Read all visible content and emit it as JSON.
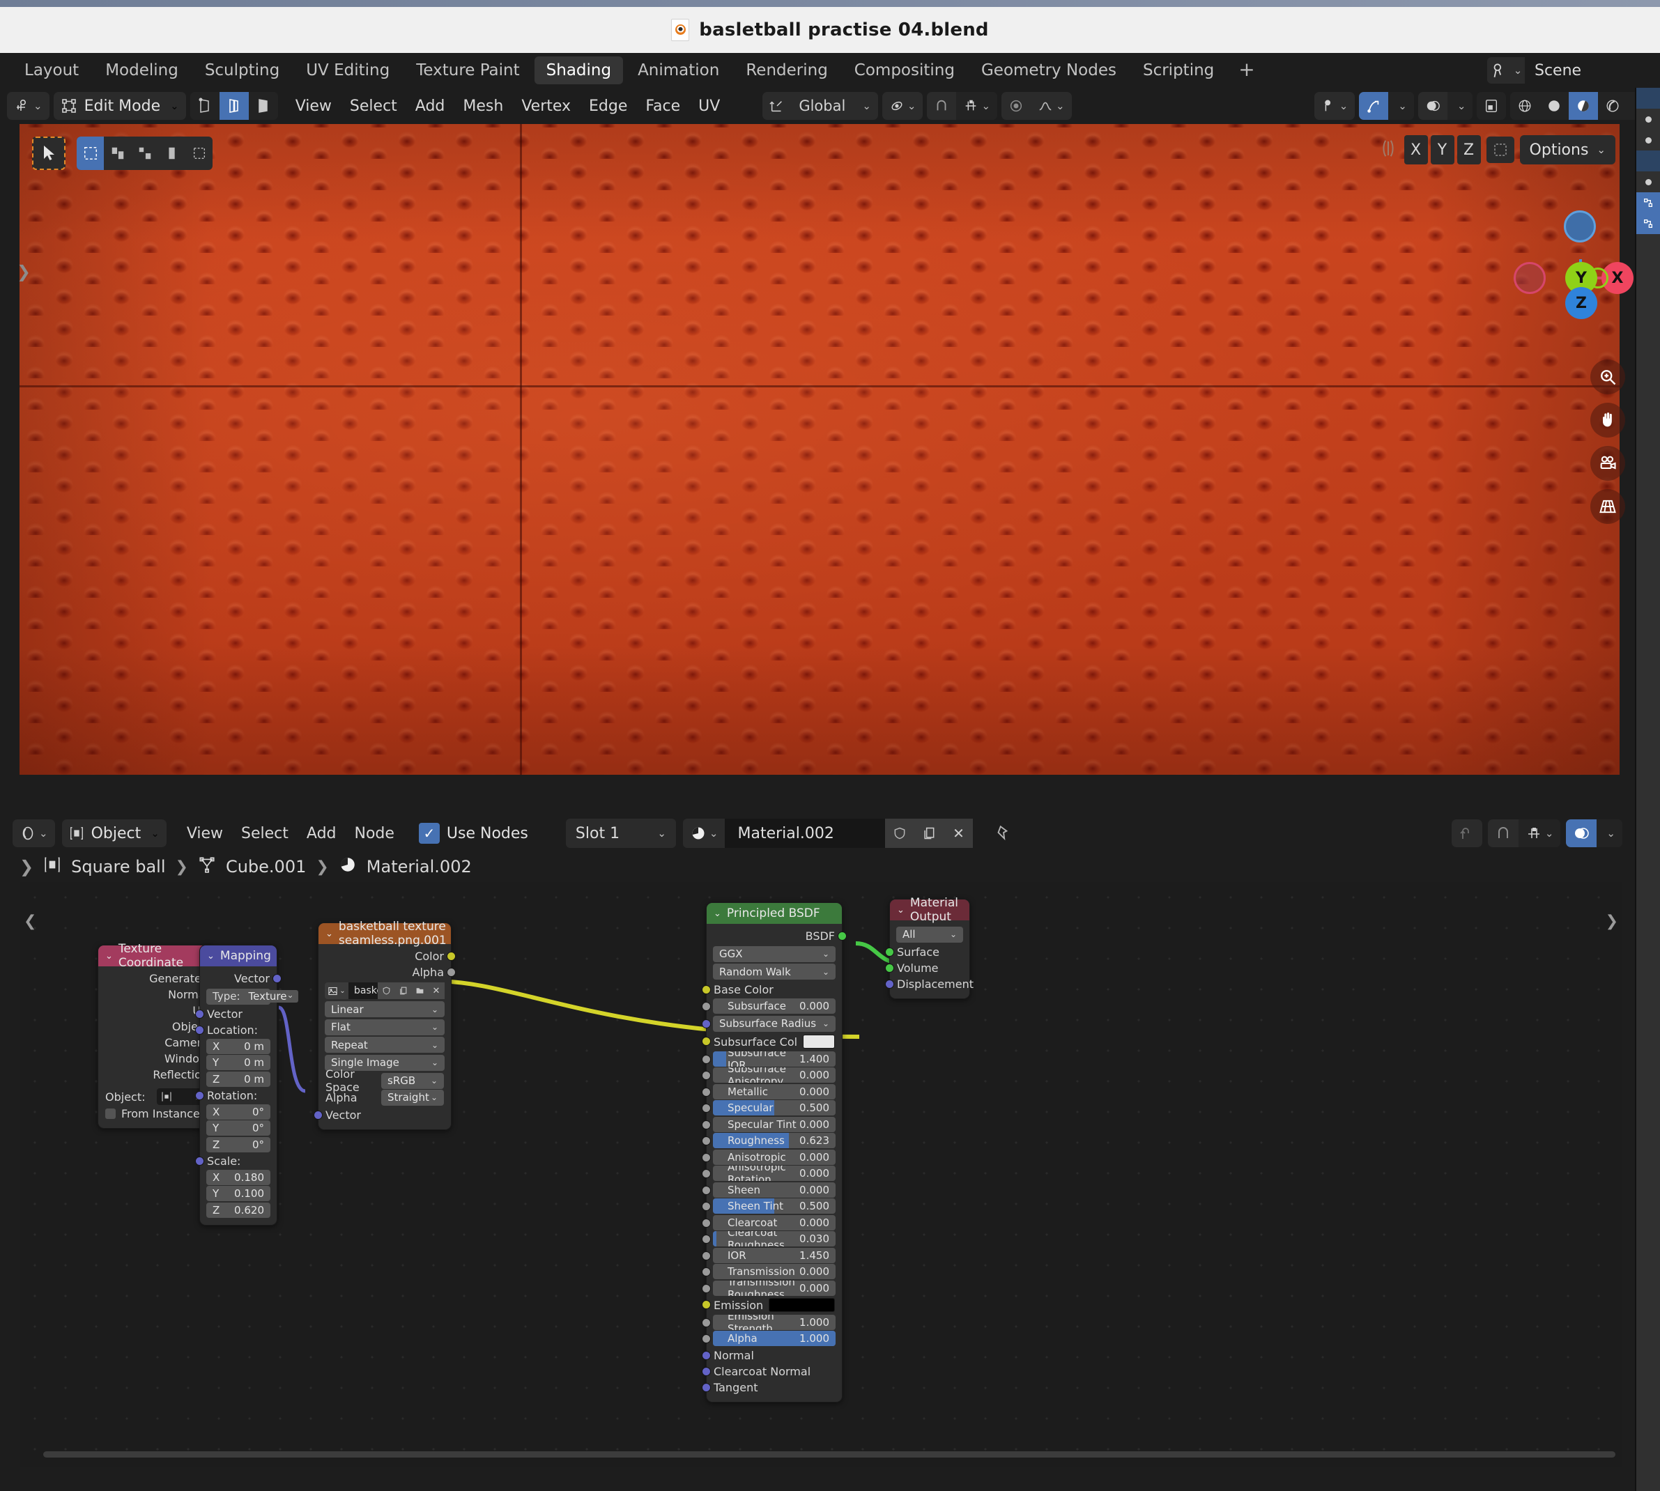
{
  "window": {
    "title": "basletball practise 04.blend",
    "file_icon": "blender-file-icon"
  },
  "topbar": {
    "workspaces": [
      {
        "label": "Layout",
        "active": false
      },
      {
        "label": "Modeling",
        "active": false
      },
      {
        "label": "Sculpting",
        "active": false
      },
      {
        "label": "UV Editing",
        "active": false
      },
      {
        "label": "Texture Paint",
        "active": false
      },
      {
        "label": "Shading",
        "active": true
      },
      {
        "label": "Animation",
        "active": false
      },
      {
        "label": "Rendering",
        "active": false
      },
      {
        "label": "Compositing",
        "active": false
      },
      {
        "label": "Geometry Nodes",
        "active": false
      },
      {
        "label": "Scripting",
        "active": false
      }
    ],
    "add_workspace": "+",
    "scene_name": "Scene"
  },
  "viewport": {
    "editor_type_icon": "editor-type-icon",
    "mode": "Edit Mode",
    "select_modes": [
      "vertex-select",
      "edge-select",
      "face-select"
    ],
    "select_mode_active": "edge-select",
    "menus": [
      "View",
      "Select",
      "Add",
      "Mesh",
      "Vertex",
      "Edge",
      "Face",
      "UV"
    ],
    "transform_orientation": "Global",
    "pivot_icon": "pivot-point-icon",
    "snap_icon": "magnet-icon",
    "snap_target_icon": "snap-increment-icon",
    "proportional_icon": "proportional-edit-icon",
    "falloff_icon": "smooth-falloff-icon",
    "visibility_icon": "visibility-icon",
    "gizmo_icon": "gizmo-icon",
    "overlays_icon": "overlays-icon",
    "xray_icon": "xray-icon",
    "shading_modes": [
      "wireframe",
      "solid",
      "material-preview",
      "rendered"
    ],
    "shading_active": "material-preview",
    "toolbar_select_icon": "tweak-select-icon",
    "mesh_select_icons": [
      "box-select",
      "lasso-select",
      "circle-select",
      "select-all"
    ],
    "axis_buttons": [
      "X",
      "Y",
      "Z"
    ],
    "mirror_icon": "mirror-icon",
    "options_label": "Options",
    "gizmo_axes": [
      "X",
      "Y",
      "Z"
    ],
    "nav_buttons": [
      "zoom-icon",
      "pan-hand-icon",
      "camera-view-icon",
      "toggle-perspective-icon"
    ]
  },
  "shader_editor": {
    "editor_icon": "shader-editor-icon",
    "shader_type": "Object",
    "menus": [
      "View",
      "Select",
      "Add",
      "Node"
    ],
    "use_nodes_label": "Use Nodes",
    "use_nodes_checked": true,
    "slot": "Slot 1",
    "material_name": "Material.002",
    "material_buttons": [
      "fake-user-shield-icon",
      "new-material-copy-icon",
      "unlink-x-icon"
    ],
    "pin_icon": "pin-icon",
    "right_icons": [
      "snap-parent-icon",
      "magnet-icon",
      "snap-node-icon",
      "overlays-icon"
    ],
    "breadcrumb": [
      {
        "icon": "object-icon",
        "label": "Square ball"
      },
      {
        "icon": "mesh-data-icon",
        "label": "Cube.001"
      },
      {
        "icon": "material-icon",
        "label": "Material.002"
      }
    ]
  },
  "nodes": {
    "texture_coordinate": {
      "title": "Texture Coordinate",
      "header_color": "#a33b5e",
      "outputs": [
        "Generated",
        "Normal",
        "UV",
        "Object",
        "Camera",
        "Window",
        "Reflection"
      ],
      "object_label": "Object:",
      "object_value": "",
      "from_instancer_label": "From Instancer",
      "from_instancer_checked": false
    },
    "mapping": {
      "title": "Mapping",
      "header_color": "#4b4b9e",
      "output": "Vector",
      "type_label": "Type:",
      "type_value": "Texture",
      "vector_label": "Vector",
      "location_label": "Location:",
      "location": [
        {
          "axis": "X",
          "value": "0 m"
        },
        {
          "axis": "Y",
          "value": "0 m"
        },
        {
          "axis": "Z",
          "value": "0 m"
        }
      ],
      "rotation_label": "Rotation:",
      "rotation": [
        {
          "axis": "X",
          "value": "0°"
        },
        {
          "axis": "Y",
          "value": "0°"
        },
        {
          "axis": "Z",
          "value": "0°"
        }
      ],
      "scale_label": "Scale:",
      "scale": [
        {
          "axis": "X",
          "value": "0.180"
        },
        {
          "axis": "Y",
          "value": "0.100"
        },
        {
          "axis": "Z",
          "value": "0.620"
        }
      ]
    },
    "image_texture": {
      "title": "basketball texture seamless.png.001",
      "header_color": "#9c5424",
      "outputs": [
        {
          "name": "Color",
          "type": "color"
        },
        {
          "name": "Alpha",
          "type": "gray"
        }
      ],
      "image_name": "basketball textur...",
      "image_buttons": [
        "fake-user-shield-icon",
        "new-image-copy-icon",
        "open-folder-icon",
        "unlink-x-icon"
      ],
      "interpolation": "Linear",
      "projection": "Flat",
      "extension": "Repeat",
      "source": "Single Image",
      "color_space_label": "Color Space",
      "color_space": "sRGB",
      "alpha_label": "Alpha",
      "alpha": "Straight",
      "vector_input": "Vector"
    },
    "principled_bsdf": {
      "title": "Principled BSDF",
      "header_color": "#3c7a3c",
      "output": "BSDF",
      "distribution": "GGX",
      "subsurface_method": "Random Walk",
      "inputs": [
        {
          "name": "Base Color",
          "kind": "socket",
          "sock": "color"
        },
        {
          "name": "Subsurface",
          "kind": "slider",
          "value": "0.000",
          "fill": 0.0,
          "sock": "gray"
        },
        {
          "name": "Subsurface Radius",
          "kind": "dropdown",
          "sock": "vector"
        },
        {
          "name": "Subsurface Col",
          "kind": "swatch",
          "color": "#e8e8e8",
          "sock": "color"
        },
        {
          "name": "Subsurface IOR",
          "kind": "slider",
          "value": "1.400",
          "fill": 0.11,
          "sock": "gray"
        },
        {
          "name": "Subsurface Anisotropy",
          "kind": "slider",
          "value": "0.000",
          "fill": 0.0,
          "sock": "gray"
        },
        {
          "name": "Metallic",
          "kind": "slider",
          "value": "0.000",
          "fill": 0.0,
          "sock": "gray"
        },
        {
          "name": "Specular",
          "kind": "slider",
          "value": "0.500",
          "fill": 0.5,
          "sock": "gray"
        },
        {
          "name": "Specular Tint",
          "kind": "slider",
          "value": "0.000",
          "fill": 0.0,
          "sock": "gray"
        },
        {
          "name": "Roughness",
          "kind": "slider",
          "value": "0.623",
          "fill": 0.623,
          "sock": "gray"
        },
        {
          "name": "Anisotropic",
          "kind": "slider",
          "value": "0.000",
          "fill": 0.0,
          "sock": "gray"
        },
        {
          "name": "Anisotropic Rotation",
          "kind": "slider",
          "value": "0.000",
          "fill": 0.0,
          "sock": "gray"
        },
        {
          "name": "Sheen",
          "kind": "slider",
          "value": "0.000",
          "fill": 0.0,
          "sock": "gray"
        },
        {
          "name": "Sheen Tint",
          "kind": "slider",
          "value": "0.500",
          "fill": 0.5,
          "sock": "gray"
        },
        {
          "name": "Clearcoat",
          "kind": "slider",
          "value": "0.000",
          "fill": 0.0,
          "sock": "gray"
        },
        {
          "name": "Clearcoat Roughness",
          "kind": "slider",
          "value": "0.030",
          "fill": 0.03,
          "sock": "gray"
        },
        {
          "name": "IOR",
          "kind": "slider",
          "value": "1.450",
          "fill": 0.0,
          "sock": "gray"
        },
        {
          "name": "Transmission",
          "kind": "slider",
          "value": "0.000",
          "fill": 0.0,
          "sock": "gray"
        },
        {
          "name": "Transmission Roughness",
          "kind": "slider",
          "value": "0.000",
          "fill": 0.0,
          "sock": "gray"
        },
        {
          "name": "Emission",
          "kind": "swatch",
          "color": "#000000",
          "sock": "color"
        },
        {
          "name": "Emission Strength",
          "kind": "slider",
          "value": "1.000",
          "fill": 0.0,
          "sock": "gray"
        },
        {
          "name": "Alpha",
          "kind": "slider",
          "value": "1.000",
          "fill": 1.0,
          "sock": "gray"
        },
        {
          "name": "Normal",
          "kind": "socket",
          "sock": "vector"
        },
        {
          "name": "Clearcoat Normal",
          "kind": "socket",
          "sock": "vector"
        },
        {
          "name": "Tangent",
          "kind": "socket",
          "sock": "vector"
        }
      ]
    },
    "material_output": {
      "title": "Material Output",
      "header_color": "#6b2b38",
      "target": "All",
      "inputs": [
        {
          "name": "Surface",
          "sock": "shader"
        },
        {
          "name": "Volume",
          "sock": "shader"
        },
        {
          "name": "Displacement",
          "sock": "vector"
        }
      ]
    }
  },
  "colors": {
    "accent_blue": "#4772b3",
    "link_color": "#d4d42a",
    "shader_link": "#46c846",
    "vector_link": "#6363c7"
  }
}
